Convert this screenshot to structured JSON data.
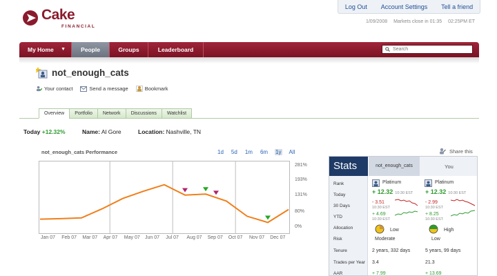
{
  "brand": {
    "name": "Cake",
    "sub": "FINANCIAL",
    "color": "#8a1b2c"
  },
  "account": {
    "logout": "Log Out",
    "settings": "Account Settings",
    "tell": "Tell a friend"
  },
  "status": {
    "date": "1/09/2008",
    "market": "Markets close in 01:35",
    "time": "02:25PM ET"
  },
  "nav": {
    "items": [
      "My Home",
      "People",
      "Groups",
      "Leaderboard"
    ],
    "active": "People",
    "search_placeholder": "Search"
  },
  "profile": {
    "username": "not_enough_cats",
    "actions": [
      "Your contact",
      "Send a message",
      "Bookmark"
    ]
  },
  "tabs": {
    "items": [
      "Overview",
      "Portfolio",
      "Network",
      "Discussions",
      "Watchlist"
    ],
    "active": "Overview"
  },
  "summary": {
    "today_label": "Today",
    "today_value": "+12.32%",
    "name_label": "Name:",
    "name_value": "Al Gore",
    "location_label": "Location:",
    "location_value": "Nashville, TN"
  },
  "performance": {
    "title": "not_enough_cats Performance",
    "ranges": [
      "1d",
      "5d",
      "1m",
      "6m",
      "1y",
      "All"
    ],
    "selected_range": "1y",
    "line_color": "#f07f1a"
  },
  "chart_data": {
    "type": "line",
    "title": "not_enough_cats Performance",
    "x": [
      "Jan 07",
      "Feb 07",
      "Mar 07",
      "Apr 07",
      "May 07",
      "Jun 07",
      "Jul 07",
      "Aug 07",
      "Sep 07",
      "Oct 07",
      "Nov 07",
      "Dec 07"
    ],
    "y_ticks": [
      "281%",
      "193%",
      "131%",
      "80%",
      "0%"
    ],
    "ylim": [
      0,
      281
    ],
    "series": [
      {
        "values": [
          50,
          52,
          55,
          93,
          136,
          166,
          193,
          150,
          154,
          125,
          62,
          36,
          90
        ]
      }
    ],
    "markers": [
      {
        "kind": "sell",
        "color": "#b0226d",
        "index": 7
      },
      {
        "kind": "buy",
        "color": "#22aa22",
        "index": 8
      },
      {
        "kind": "sell",
        "color": "#b0226d",
        "index": 8.5
      },
      {
        "kind": "buy",
        "color": "#22aa22",
        "index": 11
      }
    ]
  },
  "share": {
    "label": "Share this"
  },
  "stats": {
    "title": "Stats",
    "col_user": "not_enough_cats",
    "col_you": "You",
    "rows": [
      "Rank",
      "Today",
      "30 Days",
      "YTD",
      "Allocation",
      "Risk",
      "Tenure",
      "Trades per Year",
      "AAR"
    ],
    "user": {
      "rank": "Platinum",
      "today": "+ 12.32",
      "today_time": "10:30 EST",
      "days30": "- 3.51",
      "days30_time": "10:30 EST",
      "ytd": "+ 4.69",
      "ytd_time": "10:30 EST",
      "allocation": "Low",
      "risk": "Moderate",
      "tenure": "2 years, 332 days",
      "trades": "3.4",
      "aar": "+ 7.99"
    },
    "you": {
      "rank": "Platinum",
      "today": "+ 12.32",
      "today_time": "10:30 EST",
      "days30": "- 2.99",
      "days30_time": "10:30 EST",
      "ytd": "+ 8.25",
      "ytd_time": "10:30 EST",
      "allocation": "High",
      "risk": "Low",
      "tenure": "5 years, 99 days",
      "trades": "21.3",
      "aar": "+ 13.69"
    }
  }
}
